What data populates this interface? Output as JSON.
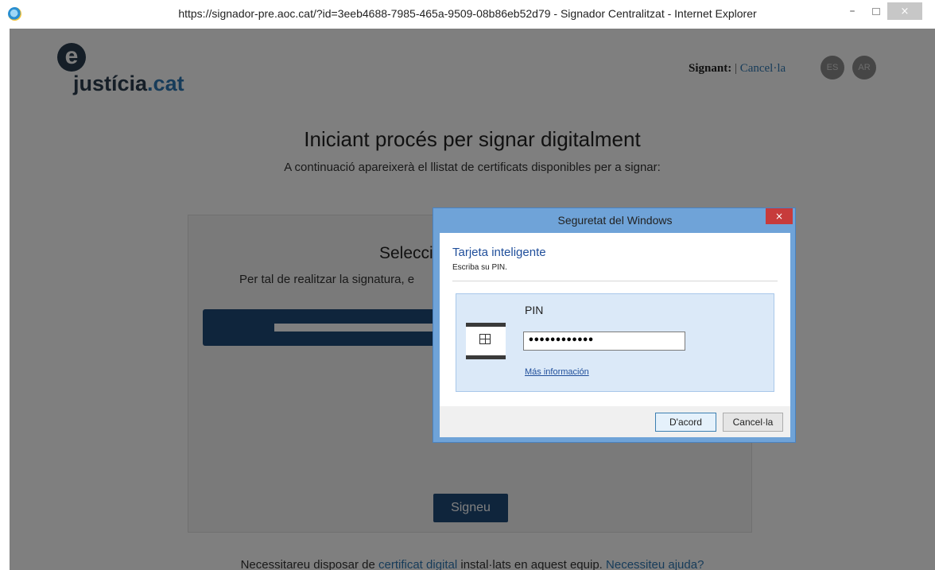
{
  "window": {
    "title": "https://signador-pre.aoc.cat/?id=3eeb4688-7985-465a-9509-08b86eb52d79 - Signador Centralitzat - Internet Explorer",
    "minimize": "–",
    "close": "×"
  },
  "header": {
    "logo_e": "e",
    "logo_main": "justícia",
    "logo_suffix": ".cat",
    "signant_label": "Signant:",
    "separator": "|",
    "cancel_link": "Cancel·la",
    "languages": [
      "ES",
      "AR"
    ]
  },
  "main": {
    "title": "Iniciant procés per signar digitalment",
    "subtitle": "A continuació apareixerà el llistat de certificats disponibles per a signar:",
    "card_title": "Selecci",
    "card_text": "Per tal de realitzar la signatura, e",
    "sign_button": "Signeu"
  },
  "footer": {
    "text_before": "Necessitareu disposar de ",
    "link_cert": "certificat digital",
    "text_middle": " instal·lats en aquest equip. ",
    "link_help": "Necessiteu ajuda?"
  },
  "dialog": {
    "title": "Seguretat del Windows",
    "close": "×",
    "heading": "Tarjeta inteligente",
    "hint": "Escriba su PIN.",
    "pin_label": "PIN",
    "pin_value": "••••••••••••",
    "more_info": "Más información",
    "ok_button": "D'acord",
    "cancel_button": "Cancel·la"
  }
}
